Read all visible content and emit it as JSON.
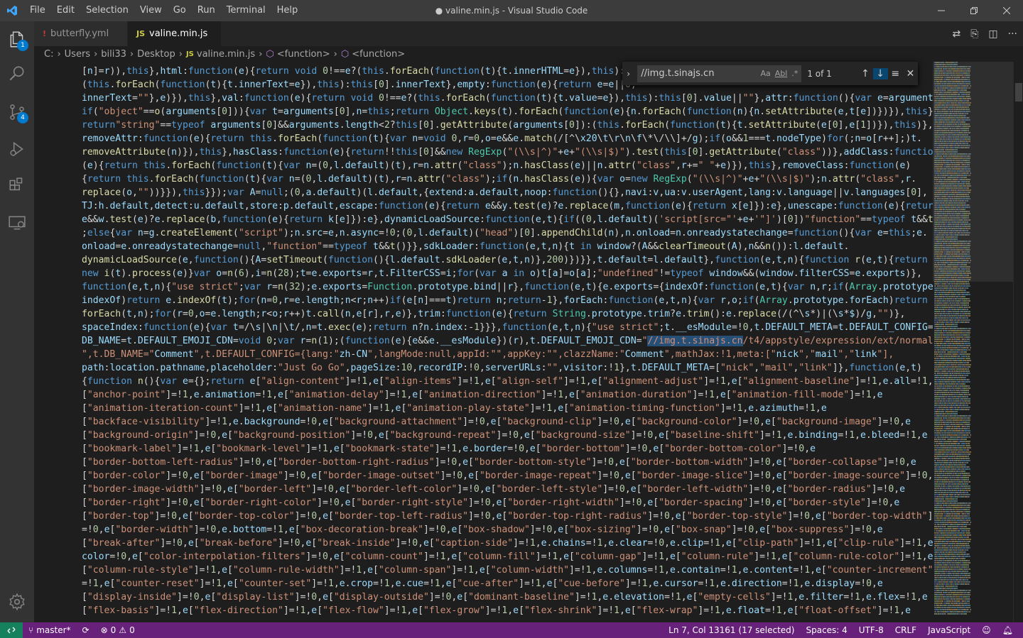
{
  "window": {
    "title": "● valine.min.js - Visual Studio Code",
    "menu": [
      "File",
      "Edit",
      "Selection",
      "View",
      "Go",
      "Run",
      "Terminal",
      "Help"
    ]
  },
  "activity_bar": {
    "items": [
      {
        "name": "explorer",
        "icon": "files-icon",
        "badge": "1"
      },
      {
        "name": "search",
        "icon": "search-icon",
        "badge": ""
      },
      {
        "name": "source-control",
        "icon": "source-control-icon",
        "badge": "4"
      },
      {
        "name": "run-debug",
        "icon": "run-debug-icon",
        "badge": ""
      },
      {
        "name": "extensions",
        "icon": "extensions-icon",
        "badge": ""
      },
      {
        "name": "remote-explorer",
        "icon": "remote-explorer-icon",
        "badge": ""
      }
    ],
    "settings_icon": "gear-icon"
  },
  "tabs": [
    {
      "icon": "!",
      "label": "butterfly.yml",
      "active": false
    },
    {
      "icon": "JS",
      "label": "valine.min.js",
      "active": true,
      "dirty": true
    }
  ],
  "breadcrumb": [
    "C:",
    "Users",
    "bili33",
    "Desktop",
    "valine.min.js",
    "<function>",
    "<function>"
  ],
  "find": {
    "query": "//img.t.sinajs.cn",
    "opt_case": "Aa",
    "opt_word": "Abl",
    "opt_regex": ".*",
    "count": "1 of 1"
  },
  "editor": {
    "lines": [
      "[n]=r)),this},html:function(e){return void 0!==e?(this.forEach(function(t){t.innerHTML=e}),this):th",
      "(this.forEach(function(t){t.innerText=e}),this):this[0].innerText},empty:function(e){return e=e||0,",
      "innerText=\"\"},e)}),this},val:function(e){return void 0!==e?(this.forEach(function(t){t.value=e}),this):this[0].value||\"\"},attr:function(){var e=arguments;",
      "if(\"object\"==o(arguments[0])){var t=arguments[0],n=this;return Object.keys(t).forEach(function(e){n.forEach(function(n){n.setAttribute(e,t[e])})}),this}",
      "return\"string\"==typeof arguments[0]&&arguments.length<2?this[0].getAttribute(arguments[0]):(this.forEach(function(t){t.setAttribute(e[0],e[1])}),this)},",
      "removeAttr:function(e){return this.forEach(function(t){var n=void 0,r=0,o=e&&e.match(/[^\\x20\\t\\r\\n\\f\\*\\/\\\\]+/g);if(o&&1===t.nodeType)for(;n=o[r++];)t.",
      "removeAttribute(n)}),this},hasClass:function(e){return!!this[0]&&new RegExp(\"(\\\\s|^)\"+e+\"(\\\\s|$)\").test(this[0].getAttribute(\"class\"))},addClass:function",
      "(e){return this.forEach(function(t){var n=(0,l.default)(t),r=n.attr(\"class\");n.hasClass(e)||n.attr(\"class\",r+=\" \"+e)}),this},removeClass:function(e)",
      "{return this.forEach(function(t){var n=(0,l.default)(t),r=n.attr(\"class\");if(n.hasClass(e)){var o=new RegExp(\"(\\\\s|^)\"+e+\"(\\\\s|$)\");n.attr(\"class\",r.",
      "replace(o,\"\"))}}),this}});var A=null;(0,a.default)(l.default,{extend:a.default,noop:function(){},navi:v,ua:v.userAgent,lang:v.language||v.languages[0],",
      "TJ:h.default,detect:u.default,store:p.default,escape:function(e){return e&&y.test(e)?e.replace(m,function(e){return x[e]}):e},unescape:function(e){return",
      "e&&w.test(e)?e.replace(b,function(e){return k[e]}):e},dynamicLoadSource:function(e,t){if((0,l.default)('script[src=\"'+e+'\"]')[0])\"function\"==typeof t&&t()",
      ";else{var n=g.createElement(\"script\");n.src=e,n.async=!0;(0,l.default)(\"head\")[0].appendChild(n),n.onload=n.onreadystatechange=function(){var e=this;e.",
      "onload=e.onreadystatechange=null,\"function\"==typeof t&&t()}},sdkLoader:function(e,t,n){t in window?(A&&clearTimeout(A),n&&n()):l.default.",
      "dynamicLoadSource(e,function(){A=setTimeout(function(){l.default.sdkLoader(e,t,n)},200)})}},t.default=l.default},function(e,t,n){function r(e,t){return",
      "new i(t).process(e)}var o=n(6),i=n(28);t=e.exports=r,t.FilterCSS=i;for(var a in o)t[a]=o[a];\"undefined\"!=typeof window&&(window.filterCSS=e.exports)},",
      "function(e,t,n){\"use strict\";var r=n(32);e.exports=Function.prototype.bind||r},function(e,t){e.exports={indexOf:function(e,t){var n,r;if(Array.prototype.",
      "indexOf)return e.indexOf(t);for(n=0,r=e.length;n<r;n++)if(e[n]===t)return n;return-1},forEach:function(e,t,n){var r,o;if(Array.prototype.forEach)return e.",
      "forEach(t,n);for(r=0,o=e.length;r<o;r++)t.call(n,e[r],r,e)},trim:function(e){return String.prototype.trim?e.trim():e.replace(/(^\\s*)|(\\s*$)/g,\"\")},",
      "spaceIndex:function(e){var t=/\\s|\\n|\\t/,n=t.exec(e);return n?n.index:-1}}},function(e,t,n){\"use strict\";t.__esModule=!0,t.DEFAULT_META=t.DEFAULT_CONFIG=t.",
      "DB_NAME=t.DEFAULT_EMOJI_CDN=void 0;var r=n(1);(function(e){e&&e.__esModule})(r),t.DEFAULT_EMOJI_CDN=\"//img.t.sinajs.cn/t4/appstyle/expression/ext/normal/",
      "\",t.DB_NAME=\"Comment\",t.DEFAULT_CONFIG={lang:\"zh-CN\",langMode:null,appId:\"\",appKey:\"\",clazzName:\"Comment\",mathJax:!1,meta:[\"nick\",\"mail\",\"link\"],",
      "path:location.pathname,placeholder:\"Just Go Go\",pageSize:10,recordIP:!0,serverURLs:\"\",visitor:!1},t.DEFAULT_META=[\"nick\",\"mail\",\"link\"]},function(e,t)",
      "{function n(){var e={};return e[\"align-content\"]=!1,e[\"align-items\"]=!1,e[\"align-self\"]=!1,e[\"alignment-adjust\"]=!1,e[\"alignment-baseline\"]=!1,e.all=!1,e",
      "[\"anchor-point\"]=!1,e.animation=!1,e[\"animation-delay\"]=!1,e[\"animation-direction\"]=!1,e[\"animation-duration\"]=!1,e[\"animation-fill-mode\"]=!1,e",
      "[\"animation-iteration-count\"]=!1,e[\"animation-name\"]=!1,e[\"animation-play-state\"]=!1,e[\"animation-timing-function\"]=!1,e.azimuth=!1,e",
      "[\"backface-visibility\"]=!1,e.background=!0,e[\"background-attachment\"]=!0,e[\"background-clip\"]=!0,e[\"background-color\"]=!0,e[\"background-image\"]=!0,e",
      "[\"background-origin\"]=!0,e[\"background-position\"]=!0,e[\"background-repeat\"]=!0,e[\"background-size\"]=!0,e[\"baseline-shift\"]=!1,e.binding=!1,e.bleed=!1,e",
      "[\"bookmark-label\"]=!1,e[\"bookmark-level\"]=!1,e[\"bookmark-state\"]=!1,e.border=!0,e[\"border-bottom\"]=!0,e[\"border-bottom-color\"]=!0,e",
      "[\"border-bottom-left-radius\"]=!0,e[\"border-bottom-right-radius\"]=!0,e[\"border-bottom-style\"]=!0,e[\"border-bottom-width\"]=!0,e[\"border-collapse\"]=!0,e",
      "[\"border-color\"]=!0,e[\"border-image\"]=!0,e[\"border-image-outset\"]=!0,e[\"border-image-repeat\"]=!0,e[\"border-image-slice\"]=!0,e[\"border-image-source\"]=!0,e",
      "[\"border-image-width\"]=!0,e[\"border-left\"]=!0,e[\"border-left-color\"]=!0,e[\"border-left-style\"]=!0,e[\"border-left-width\"]=!0,e[\"border-radius\"]=!0,e",
      "[\"border-right\"]=!0,e[\"border-right-color\"]=!0,e[\"border-right-style\"]=!0,e[\"border-right-width\"]=!0,e[\"border-spacing\"]=!0,e[\"border-style\"]=!0,e",
      "[\"border-top\"]=!0,e[\"border-top-color\"]=!0,e[\"border-top-left-radius\"]=!0,e[\"border-top-right-radius\"]=!0,e[\"border-top-style\"]=!0,e[\"border-top-width\"]",
      "=!0,e[\"border-width\"]=!0,e.bottom=!1,e[\"box-decoration-break\"]=!0,e[\"box-shadow\"]=!0,e[\"box-sizing\"]=!0,e[\"box-snap\"]=!0,e[\"box-suppress\"]=!0,e",
      "[\"break-after\"]=!0,e[\"break-before\"]=!0,e[\"break-inside\"]=!0,e[\"caption-side\"]=!1,e.chains=!1,e.clear=!0,e.clip=!1,e[\"clip-path\"]=!1,e[\"clip-rule\"]=!1,e.",
      "color=!0,e[\"color-interpolation-filters\"]=!0,e[\"column-count\"]=!1,e[\"column-fill\"]=!1,e[\"column-gap\"]=!1,e[\"column-rule\"]=!1,e[\"column-rule-color\"]=!1,e",
      "[\"column-rule-style\"]=!1,e[\"column-rule-width\"]=!1,e[\"column-span\"]=!1,e[\"column-width\"]=!1,e.columns=!1,e.contain=!1,e.content=!1,e[\"counter-increment\"]",
      "=!1,e[\"counter-reset\"]=!1,e[\"counter-set\"]=!1,e.crop=!1,e.cue=!1,e[\"cue-after\"]=!1,e[\"cue-before\"]=!1,e.cursor=!1,e.direction=!1,e.display=!0,e",
      "[\"display-inside\"]=!0,e[\"display-list\"]=!0,e[\"display-outside\"]=!0,e[\"dominant-baseline\"]=!1,e.elevation=!1,e[\"empty-cells\"]=!1,e.filter=!1,e.flex=!1,e",
      "[\"flex-basis\"]=!1,e[\"flex-direction\"]=!1,e[\"flex-flow\"]=!1,e[\"flex-grow\"]=!1,e[\"flex-shrink\"]=!1,e[\"flex-wrap\"]=!1,e.float=!1,e[\"float-offset\"]=!1,e"
    ],
    "selected_text": "//img.t.sinajs.cn"
  },
  "statusbar": {
    "branch": "master*",
    "errors": "0",
    "warnings": "0",
    "position": "Ln 7, Col 13161 (17 selected)",
    "spaces": "Spaces: 4",
    "encoding": "UTF-8",
    "eol": "CRLF",
    "language": "JavaScript"
  },
  "colors": {
    "statusbar": "#68217a",
    "activitybar": "#333333",
    "editor_bg": "#1e1e1e",
    "accent": "#007acc",
    "selection": "#264f78"
  }
}
